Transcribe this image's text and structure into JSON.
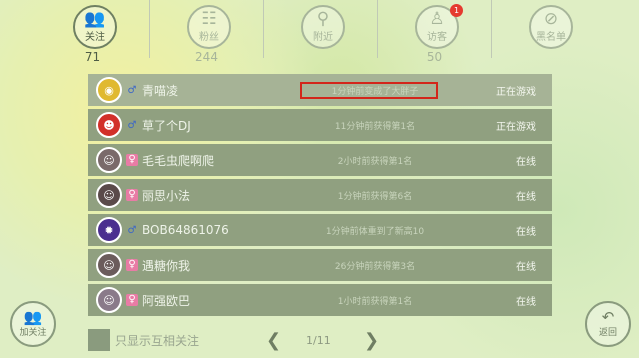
{
  "tabs": [
    {
      "label": "关注",
      "count": "71",
      "icon": "users-icon",
      "active": true
    },
    {
      "label": "粉丝",
      "count": "244",
      "icon": "group-icon",
      "active": false
    },
    {
      "label": "附近",
      "count": "",
      "icon": "location-icon",
      "active": false
    },
    {
      "label": "访客",
      "count": "50",
      "icon": "person-icon",
      "active": false,
      "badge": "1"
    },
    {
      "label": "黑名单",
      "count": "",
      "icon": "blocked-user-icon",
      "active": false
    }
  ],
  "friends": [
    {
      "name": "青喵凌",
      "gender": "♂",
      "activity": "1分钟前变成了大胖子",
      "status": "正在游戏",
      "avatar_color": "#e0b930"
    },
    {
      "name": "草了个DJ",
      "gender": "♂",
      "activity": "11分钟前获得第1名",
      "status": "正在游戏",
      "avatar_color": "#d2302a"
    },
    {
      "name": "毛毛虫爬啊爬",
      "gender": "♀",
      "activity": "2小时前获得第1名",
      "status": "在线",
      "avatar_color": "#7a6a6a"
    },
    {
      "name": "丽思小法",
      "gender": "♀",
      "activity": "1分钟前获得第6名",
      "status": "在线",
      "avatar_color": "#5a4a4a"
    },
    {
      "name": "BOB64861076",
      "gender": "♂",
      "activity": "1分钟前体重到了新高10",
      "status": "在线",
      "avatar_color": "#4b2f8f"
    },
    {
      "name": "遇糖你我",
      "gender": "♀",
      "activity": "26分钟前获得第3名",
      "status": "在线",
      "avatar_color": "#6b5c5c"
    },
    {
      "name": "阿强欧巴",
      "gender": "♀",
      "activity": "1小时前获得第1名",
      "status": "在线",
      "avatar_color": "#8a7a8a"
    }
  ],
  "footer": {
    "mutual_label": "只显示互相关注",
    "page": "1/11",
    "follow_label": "加关注",
    "back_label": "返回"
  }
}
